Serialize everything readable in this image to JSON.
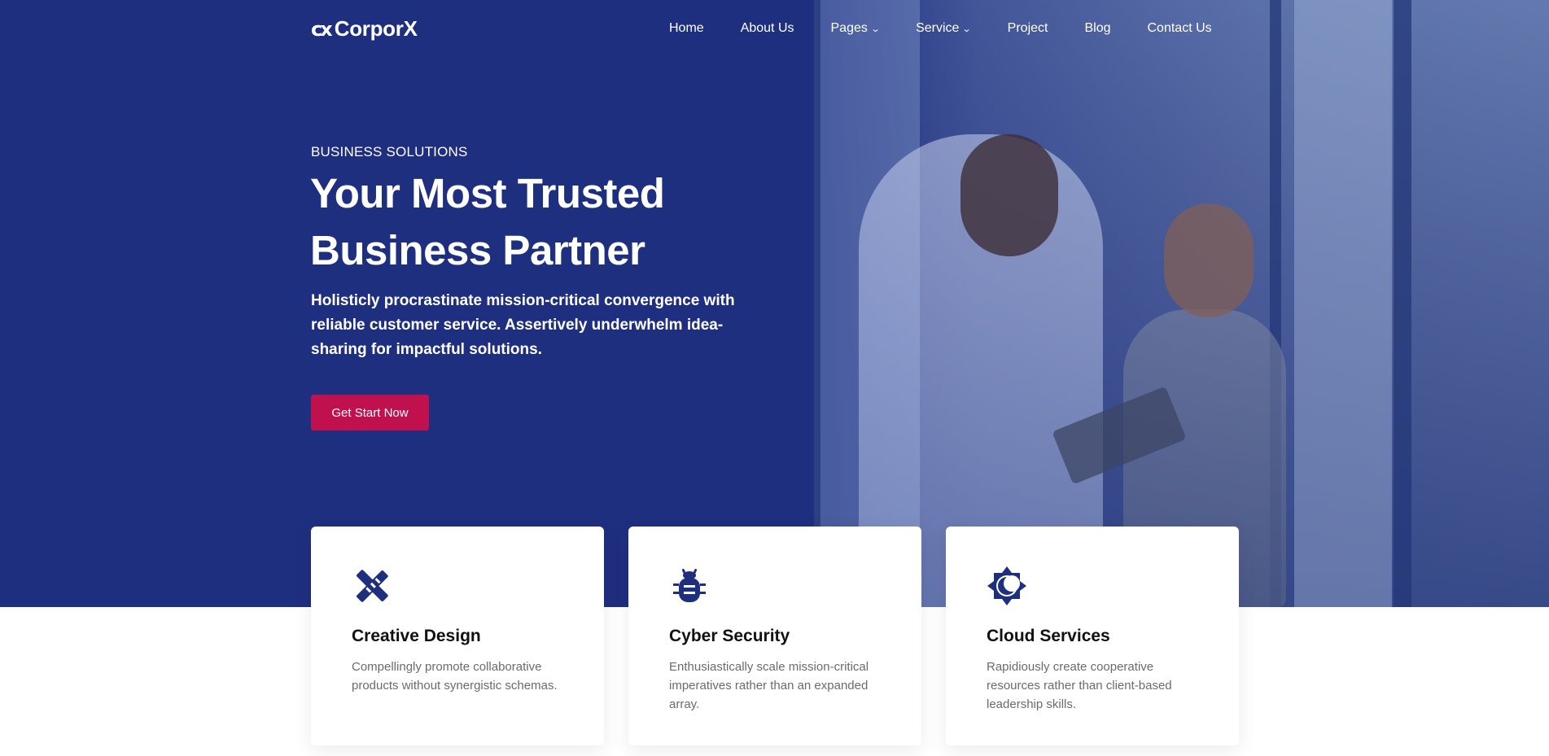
{
  "brand": {
    "logo_mark": "cx",
    "name": "CorporX",
    "primary_color": "#1f2f7f",
    "accent_color": "#c0114e"
  },
  "nav": {
    "items": [
      {
        "label": "Home"
      },
      {
        "label": "About Us"
      },
      {
        "label": "Pages",
        "dropdown": true
      },
      {
        "label": "Service",
        "dropdown": true
      },
      {
        "label": "Project"
      },
      {
        "label": "Blog"
      },
      {
        "label": "Contact Us"
      }
    ]
  },
  "hero": {
    "kicker": "BUSINESS SOLUTIONS",
    "headline": "Your Most Trusted Business Partner",
    "lead": "Holisticly procrastinate mission-critical convergence with reliable customer service. Assertively underwhelm idea-sharing for impactful solutions.",
    "cta_label": "Get Start Now"
  },
  "features": [
    {
      "icon": "design-tools-icon",
      "title": "Creative Design",
      "text": "Compellingly promote collaborative products without synergistic schemas."
    },
    {
      "icon": "bug-icon",
      "title": "Cyber Security",
      "text": "Enthusiastically scale mission-critical imperatives rather than an expanded array."
    },
    {
      "icon": "cloud-moon-icon",
      "title": "Cloud Services",
      "text": "Rapidiously create cooperative resources rather than client-based leadership skills."
    }
  ]
}
